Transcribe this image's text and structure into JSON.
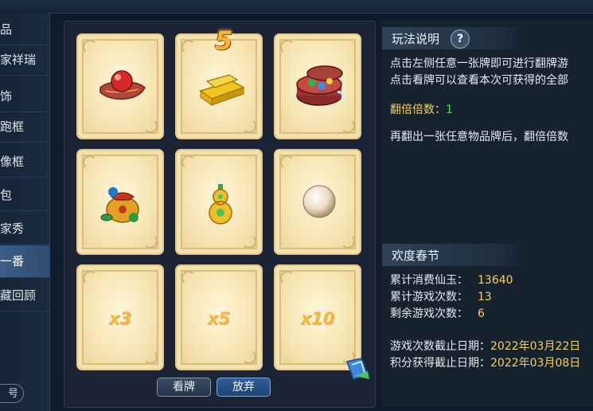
{
  "sidebar": {
    "items": [
      {
        "label": "品"
      },
      {
        "label": "家祥瑞"
      },
      {
        "label": "饰"
      },
      {
        "label": "跑框"
      },
      {
        "label": "像框"
      },
      {
        "label": "包"
      },
      {
        "label": "家秀"
      },
      {
        "label": "一番"
      },
      {
        "label": "藏回顾"
      }
    ],
    "active_index": 7,
    "bottom_pill": "号"
  },
  "cards": [
    {
      "item": "red-orb-on-cloth",
      "badge": ""
    },
    {
      "item": "gold-ingots",
      "badge": "5"
    },
    {
      "item": "treasure-box",
      "badge": ""
    },
    {
      "item": "fortune-pouch",
      "badge": ""
    },
    {
      "item": "golden-gourd",
      "badge": ""
    },
    {
      "item": "pearl",
      "badge": ""
    },
    {
      "item": "multiplier",
      "label": "x3"
    },
    {
      "item": "multiplier",
      "label": "x5"
    },
    {
      "item": "multiplier",
      "label": "x10"
    }
  ],
  "buttons": {
    "view": "看牌",
    "quit": "放弃"
  },
  "rules": {
    "title": "玩法说明",
    "help": "?",
    "line1": "点击左侧任意一张牌即可进行翻牌游",
    "line2": "点击看牌可以查看本次可获得的全部",
    "multiplier_label": "翻倍倍数：",
    "multiplier_value": "1",
    "line3": "再翻出一张任意物品牌后，翻倍倍数"
  },
  "event": {
    "title": "欢度春节",
    "stats": [
      {
        "label": "累计消费仙玉：",
        "value": "13640"
      },
      {
        "label": "累计游戏次数：",
        "value": "13"
      },
      {
        "label": "剩余游戏次数：",
        "value": "6"
      }
    ],
    "dates": [
      {
        "label": "游戏次数截止日期：",
        "value": "2022年03月22日"
      },
      {
        "label": "积分获得截止日期：",
        "value": "2022年03月08日"
      }
    ]
  },
  "colors": {
    "accent_yellow": "#f3d25a",
    "multiplier_green": "#4fd94f",
    "card_border": "#e0c98a"
  }
}
